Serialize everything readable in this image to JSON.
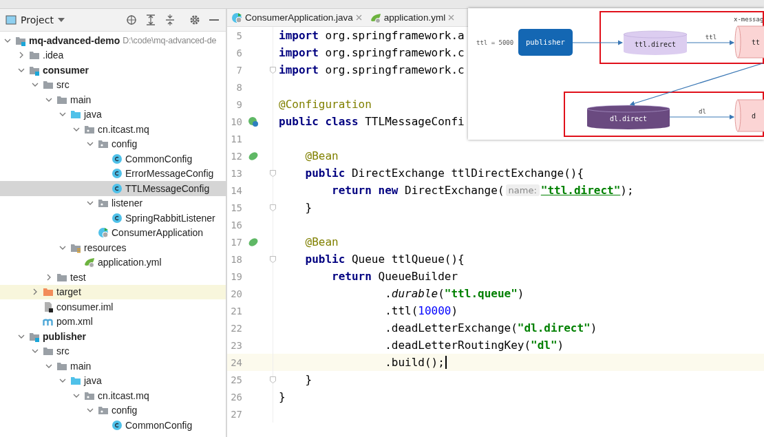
{
  "project_panel": {
    "title": "Project"
  },
  "tree": [
    {
      "label": "mq-advanced-demo",
      "kind": "module",
      "bold": true,
      "note": "D:\\code\\mq-advanced-de",
      "expanded": true,
      "selected": false,
      "highlighted": false,
      "children": [
        {
          "label": ".idea",
          "kind": "folder",
          "bold": false,
          "expanded": false,
          "selected": false,
          "highlighted": false
        },
        {
          "label": "consumer",
          "kind": "module",
          "bold": true,
          "expanded": true,
          "selected": false,
          "highlighted": false,
          "children": [
            {
              "label": "src",
              "kind": "folder",
              "bold": false,
              "expanded": true,
              "selected": false,
              "highlighted": false,
              "children": [
                {
                  "label": "main",
                  "kind": "folder",
                  "bold": false,
                  "expanded": true,
                  "selected": false,
                  "highlighted": false,
                  "children": [
                    {
                      "label": "java",
                      "kind": "source-folder",
                      "bold": false,
                      "expanded": true,
                      "selected": false,
                      "highlighted": false,
                      "children": [
                        {
                          "label": "cn.itcast.mq",
                          "kind": "package",
                          "bold": false,
                          "expanded": true,
                          "selected": false,
                          "highlighted": false,
                          "children": [
                            {
                              "label": "config",
                              "kind": "package",
                              "bold": false,
                              "expanded": true,
                              "selected": false,
                              "highlighted": false,
                              "children": [
                                {
                                  "label": "CommonConfig",
                                  "kind": "class",
                                  "bold": false,
                                  "selected": false,
                                  "highlighted": false
                                },
                                {
                                  "label": "ErrorMessageConfig",
                                  "kind": "class",
                                  "bold": false,
                                  "selected": false,
                                  "highlighted": false
                                },
                                {
                                  "label": "TTLMessageConfig",
                                  "kind": "class",
                                  "bold": false,
                                  "selected": true,
                                  "highlighted": false
                                }
                              ]
                            },
                            {
                              "label": "listener",
                              "kind": "package",
                              "bold": false,
                              "expanded": true,
                              "selected": false,
                              "highlighted": false,
                              "children": [
                                {
                                  "label": "SpringRabbitListener",
                                  "kind": "class",
                                  "bold": false,
                                  "selected": false,
                                  "highlighted": false
                                }
                              ]
                            },
                            {
                              "label": "ConsumerApplication",
                              "kind": "spring-class",
                              "bold": false,
                              "selected": false,
                              "highlighted": false
                            }
                          ]
                        }
                      ]
                    },
                    {
                      "label": "resources",
                      "kind": "resources",
                      "bold": false,
                      "expanded": true,
                      "selected": false,
                      "highlighted": false,
                      "children": [
                        {
                          "label": "application.yml",
                          "kind": "yml",
                          "bold": false,
                          "selected": false,
                          "highlighted": false
                        }
                      ]
                    }
                  ]
                },
                {
                  "label": "test",
                  "kind": "folder",
                  "bold": false,
                  "expanded": false,
                  "selected": false,
                  "highlighted": false
                }
              ]
            },
            {
              "label": "target",
              "kind": "excluded",
              "bold": false,
              "expanded": false,
              "selected": false,
              "highlighted": true
            },
            {
              "label": "consumer.iml",
              "kind": "iml",
              "bold": false,
              "selected": false,
              "highlighted": false
            },
            {
              "label": "pom.xml",
              "kind": "maven",
              "bold": false,
              "selected": false,
              "highlighted": false
            }
          ]
        },
        {
          "label": "publisher",
          "kind": "module",
          "bold": true,
          "expanded": true,
          "selected": false,
          "highlighted": false,
          "children": [
            {
              "label": "src",
              "kind": "folder",
              "bold": false,
              "expanded": true,
              "selected": false,
              "highlighted": false,
              "children": [
                {
                  "label": "main",
                  "kind": "folder",
                  "bold": false,
                  "expanded": true,
                  "selected": false,
                  "highlighted": false,
                  "children": [
                    {
                      "label": "java",
                      "kind": "source-folder",
                      "bold": false,
                      "expanded": true,
                      "selected": false,
                      "highlighted": false,
                      "children": [
                        {
                          "label": "cn.itcast.mq",
                          "kind": "package",
                          "bold": false,
                          "expanded": true,
                          "selected": false,
                          "highlighted": false,
                          "children": [
                            {
                              "label": "config",
                              "kind": "package",
                              "bold": false,
                              "expanded": true,
                              "selected": false,
                              "highlighted": false,
                              "children": [
                                {
                                  "label": "CommonConfig",
                                  "kind": "class",
                                  "bold": false,
                                  "selected": false,
                                  "highlighted": false
                                }
                              ]
                            }
                          ]
                        }
                      ]
                    }
                  ]
                }
              ]
            }
          ]
        }
      ]
    }
  ],
  "editor_tabs": [
    {
      "label": "ConsumerApplication.java",
      "kind": "spring-class",
      "selected": false
    },
    {
      "label": "application.yml",
      "kind": "yml",
      "selected": false
    }
  ],
  "code_lines": [
    {
      "number": "5",
      "kind": "plain",
      "fold": false,
      "current": false,
      "segments": [
        {
          "kind": "keyword",
          "text": "import"
        },
        {
          "kind": "plain",
          "text": " org.springframework.a"
        }
      ]
    },
    {
      "number": "6",
      "kind": "plain",
      "fold": false,
      "current": false,
      "segments": [
        {
          "kind": "keyword",
          "text": "import"
        },
        {
          "kind": "plain",
          "text": " org.springframework.c"
        }
      ]
    },
    {
      "number": "7",
      "kind": "plain",
      "fold": true,
      "current": false,
      "segments": [
        {
          "kind": "keyword",
          "text": "import"
        },
        {
          "kind": "plain",
          "text": " org.springframework.c"
        }
      ]
    },
    {
      "number": "8",
      "kind": "plain",
      "fold": false,
      "current": false
    },
    {
      "number": "9",
      "kind": "plain",
      "fold": false,
      "current": false,
      "segments": [
        {
          "kind": "annotation",
          "text": "@Configuration"
        }
      ]
    },
    {
      "number": "10",
      "kind": "class",
      "fold": false,
      "current": false,
      "segments": [
        {
          "kind": "keyword",
          "text": "public class"
        },
        {
          "kind": "plain",
          "text": " TTLMessageConfi"
        }
      ]
    },
    {
      "number": "11",
      "kind": "plain",
      "fold": false,
      "current": false
    },
    {
      "number": "12",
      "kind": "bean",
      "fold": false,
      "current": false,
      "segments": [
        {
          "kind": "annotation",
          "text": "    @Bean"
        }
      ]
    },
    {
      "number": "13",
      "kind": "plain",
      "fold": true,
      "current": false,
      "segments": [
        {
          "kind": "keyword",
          "text": "    public"
        },
        {
          "kind": "plain",
          "text": " DirectExchange ttlDirectExchange(){"
        }
      ]
    },
    {
      "number": "14",
      "kind": "plain",
      "fold": false,
      "current": false,
      "segments": [
        {
          "kind": "keyword",
          "text": "        return new"
        },
        {
          "kind": "plain",
          "text": " DirectExchange("
        },
        {
          "kind": "hint",
          "text": "name:"
        },
        {
          "kind": "link-string",
          "text": "\"ttl.direct\""
        },
        {
          "kind": "plain",
          "text": ");"
        }
      ]
    },
    {
      "number": "15",
      "kind": "plain",
      "fold": true,
      "current": false,
      "segments": [
        {
          "kind": "plain",
          "text": "    }"
        }
      ]
    },
    {
      "number": "16",
      "kind": "plain",
      "fold": false,
      "current": false
    },
    {
      "number": "17",
      "kind": "bean",
      "fold": false,
      "current": false,
      "segments": [
        {
          "kind": "annotation",
          "text": "    @Bean"
        }
      ]
    },
    {
      "number": "18",
      "kind": "plain",
      "fold": true,
      "current": false,
      "segments": [
        {
          "kind": "keyword",
          "text": "    public"
        },
        {
          "kind": "plain",
          "text": " Queue ttlQueue(){"
        }
      ]
    },
    {
      "number": "19",
      "kind": "plain",
      "fold": false,
      "current": false,
      "segments": [
        {
          "kind": "keyword",
          "text": "        return"
        },
        {
          "kind": "plain",
          "text": " QueueBuilder"
        }
      ]
    },
    {
      "number": "20",
      "kind": "plain",
      "fold": false,
      "current": false,
      "segments": [
        {
          "kind": "plain",
          "text": "                ."
        },
        {
          "kind": "method",
          "text": "durable"
        },
        {
          "kind": "plain",
          "text": "("
        },
        {
          "kind": "string",
          "text": "\"ttl.queue\""
        },
        {
          "kind": "plain",
          "text": ")"
        }
      ]
    },
    {
      "number": "21",
      "kind": "plain",
      "fold": false,
      "current": false,
      "segments": [
        {
          "kind": "plain",
          "text": "                .ttl("
        },
        {
          "kind": "number",
          "text": "10000"
        },
        {
          "kind": "plain",
          "text": ")"
        }
      ]
    },
    {
      "number": "22",
      "kind": "plain",
      "fold": false,
      "current": false,
      "segments": [
        {
          "kind": "plain",
          "text": "                .deadLetterExchange("
        },
        {
          "kind": "string",
          "text": "\"dl.direct\""
        },
        {
          "kind": "plain",
          "text": ")"
        }
      ]
    },
    {
      "number": "23",
      "kind": "plain",
      "fold": false,
      "current": false,
      "segments": [
        {
          "kind": "plain",
          "text": "                .deadLetterRoutingKey("
        },
        {
          "kind": "string",
          "text": "\"dl\""
        },
        {
          "kind": "plain",
          "text": ")"
        }
      ]
    },
    {
      "number": "24",
      "kind": "plain",
      "fold": false,
      "current": true,
      "segments": [
        {
          "kind": "plain",
          "text": "                .build();"
        }
      ]
    },
    {
      "number": "25",
      "kind": "plain",
      "fold": true,
      "current": false,
      "segments": [
        {
          "kind": "plain",
          "text": "    }"
        }
      ]
    },
    {
      "number": "26",
      "kind": "plain",
      "fold": false,
      "current": false,
      "segments": [
        {
          "kind": "plain",
          "text": "}"
        }
      ]
    },
    {
      "number": "27",
      "kind": "plain",
      "fold": false,
      "current": false
    }
  ],
  "diagram": {
    "ttl_note": "ttl = 5000",
    "publisher": "publisher",
    "header": "x-messag",
    "exchanges": [
      {
        "label": "ttl.direct",
        "color": "#dccdf0",
        "routing_key": "ttl",
        "queue_label": "tt"
      },
      {
        "label": "dl.direct",
        "color": "#6a4a80",
        "routing_key": "dl",
        "queue_label": "d"
      }
    ]
  }
}
